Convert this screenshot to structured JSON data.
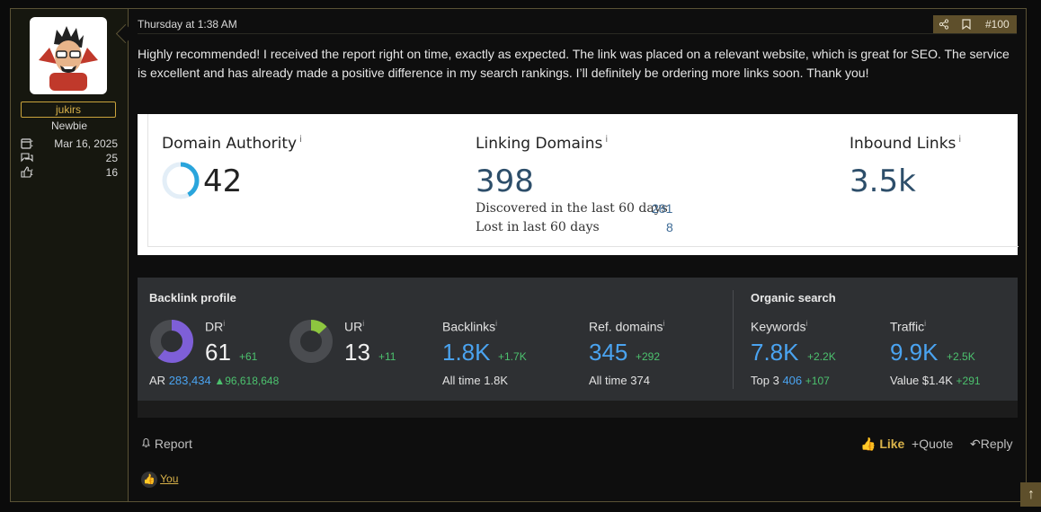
{
  "post": {
    "date": "Thursday at 1:38 AM",
    "post_number": "#100",
    "message": "Highly recommended! I received the report right on time, exactly as expected. The link was placed on a relevant website, which is great for SEO. The service is excellent and has already made a positive difference in my search rankings. I’ll definitely be ordering more links soon. Thank you!"
  },
  "user": {
    "name": "jukirs",
    "title": "Newbie",
    "joined": "Mar 16, 2025",
    "messages": "25",
    "reactions": "16",
    "stat_sep": ":"
  },
  "moz": {
    "da_label": "Domain Authority",
    "da_value": "42",
    "da_fraction": 0.42,
    "ld_label": "Linking Domains",
    "ld_value": "398",
    "discovered_label": "Discovered in the last 60 days",
    "discovered_value": "281",
    "lost_label": "Lost in last 60 days",
    "lost_value": "8",
    "il_label": "Inbound Links",
    "il_value": "3.5k",
    "info": "i"
  },
  "ahrefs": {
    "backlink_title": "Backlink profile",
    "organic_title": "Organic search",
    "dr_label": "DR",
    "dr_value": "61",
    "dr_delta": "+61",
    "dr_fraction": 0.61,
    "ur_label": "UR",
    "ur_value": "13",
    "ur_delta": "+11",
    "ur_fraction": 0.13,
    "ar_label": "AR",
    "ar_value": "283,434",
    "ar_delta": "96,618,648",
    "backlinks_label": "Backlinks",
    "backlinks_value": "1.8K",
    "backlinks_delta": "+1.7K",
    "backlinks_sub_label": "All time",
    "backlinks_sub_value": "1.8K",
    "ref_label": "Ref. domains",
    "ref_value": "345",
    "ref_delta": "+292",
    "ref_sub_label": "All time",
    "ref_sub_value": "374",
    "kw_label": "Keywords",
    "kw_value": "7.8K",
    "kw_delta": "+2.2K",
    "kw_sub_label": "Top 3",
    "kw_sub_value": "406",
    "kw_sub_delta": "+107",
    "traffic_label": "Traffic",
    "traffic_value": "9.9K",
    "traffic_delta": "+2.5K",
    "traffic_sub_label": "Value",
    "traffic_sub_value": "$1.4K",
    "traffic_sub_delta": "+291",
    "info": "i"
  },
  "footer": {
    "report": "Report",
    "like": "Like",
    "quote": "Quote",
    "reply": "Reply",
    "reacted": "You"
  },
  "colors": {
    "accent": "#d9b24a",
    "ahrefs_blue": "#4aa3f0",
    "ahrefs_green": "#4cc16e",
    "dr_purple": "#7e5fd8",
    "ur_green": "#8dc63f",
    "moz_blue": "#2d4e6a"
  }
}
